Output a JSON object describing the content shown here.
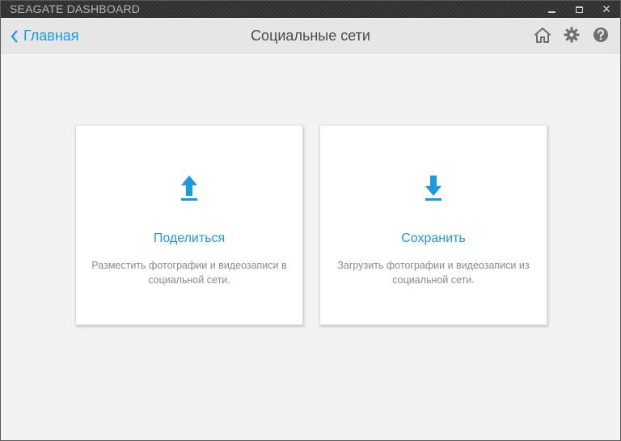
{
  "window": {
    "title": "SEAGATE DASHBOARD",
    "controls": {
      "minimize": "minimize",
      "maximize": "maximize",
      "close": "✕"
    }
  },
  "header": {
    "back_label": "Главная",
    "title": "Социальные сети",
    "icons": [
      "home-icon",
      "gear-icon",
      "help-icon"
    ]
  },
  "cards": [
    {
      "title": "Поделиться",
      "description": "Разместить фотографии и видеозаписи в социальной сети.",
      "icon": "upload-icon"
    },
    {
      "title": "Сохранить",
      "description": "Загрузить фотографии и видеозаписи из социальной сети.",
      "icon": "download-icon"
    }
  ],
  "colors": {
    "accent": "#1a9be0",
    "background": "#f2f2f2",
    "header": "#e6e6e6",
    "titlebar": "#333333"
  }
}
